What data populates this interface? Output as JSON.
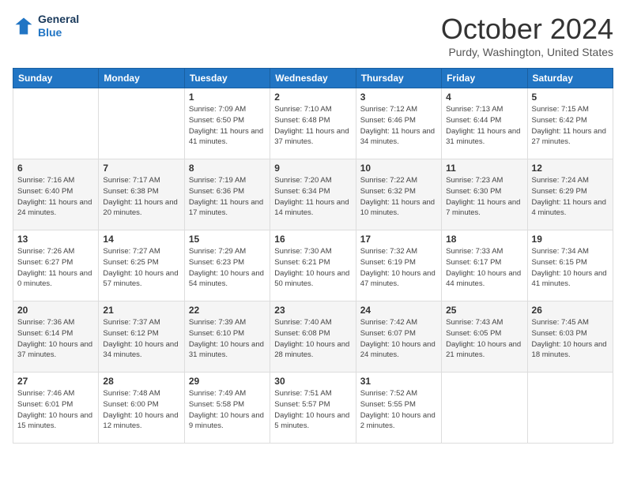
{
  "header": {
    "logo_line1": "General",
    "logo_line2": "Blue",
    "month": "October 2024",
    "location": "Purdy, Washington, United States"
  },
  "days_of_week": [
    "Sunday",
    "Monday",
    "Tuesday",
    "Wednesday",
    "Thursday",
    "Friday",
    "Saturday"
  ],
  "weeks": [
    [
      {
        "day": "",
        "info": ""
      },
      {
        "day": "",
        "info": ""
      },
      {
        "day": "1",
        "info": "Sunrise: 7:09 AM\nSunset: 6:50 PM\nDaylight: 11 hours and 41 minutes."
      },
      {
        "day": "2",
        "info": "Sunrise: 7:10 AM\nSunset: 6:48 PM\nDaylight: 11 hours and 37 minutes."
      },
      {
        "day": "3",
        "info": "Sunrise: 7:12 AM\nSunset: 6:46 PM\nDaylight: 11 hours and 34 minutes."
      },
      {
        "day": "4",
        "info": "Sunrise: 7:13 AM\nSunset: 6:44 PM\nDaylight: 11 hours and 31 minutes."
      },
      {
        "day": "5",
        "info": "Sunrise: 7:15 AM\nSunset: 6:42 PM\nDaylight: 11 hours and 27 minutes."
      }
    ],
    [
      {
        "day": "6",
        "info": "Sunrise: 7:16 AM\nSunset: 6:40 PM\nDaylight: 11 hours and 24 minutes."
      },
      {
        "day": "7",
        "info": "Sunrise: 7:17 AM\nSunset: 6:38 PM\nDaylight: 11 hours and 20 minutes."
      },
      {
        "day": "8",
        "info": "Sunrise: 7:19 AM\nSunset: 6:36 PM\nDaylight: 11 hours and 17 minutes."
      },
      {
        "day": "9",
        "info": "Sunrise: 7:20 AM\nSunset: 6:34 PM\nDaylight: 11 hours and 14 minutes."
      },
      {
        "day": "10",
        "info": "Sunrise: 7:22 AM\nSunset: 6:32 PM\nDaylight: 11 hours and 10 minutes."
      },
      {
        "day": "11",
        "info": "Sunrise: 7:23 AM\nSunset: 6:30 PM\nDaylight: 11 hours and 7 minutes."
      },
      {
        "day": "12",
        "info": "Sunrise: 7:24 AM\nSunset: 6:29 PM\nDaylight: 11 hours and 4 minutes."
      }
    ],
    [
      {
        "day": "13",
        "info": "Sunrise: 7:26 AM\nSunset: 6:27 PM\nDaylight: 11 hours and 0 minutes."
      },
      {
        "day": "14",
        "info": "Sunrise: 7:27 AM\nSunset: 6:25 PM\nDaylight: 10 hours and 57 minutes."
      },
      {
        "day": "15",
        "info": "Sunrise: 7:29 AM\nSunset: 6:23 PM\nDaylight: 10 hours and 54 minutes."
      },
      {
        "day": "16",
        "info": "Sunrise: 7:30 AM\nSunset: 6:21 PM\nDaylight: 10 hours and 50 minutes."
      },
      {
        "day": "17",
        "info": "Sunrise: 7:32 AM\nSunset: 6:19 PM\nDaylight: 10 hours and 47 minutes."
      },
      {
        "day": "18",
        "info": "Sunrise: 7:33 AM\nSunset: 6:17 PM\nDaylight: 10 hours and 44 minutes."
      },
      {
        "day": "19",
        "info": "Sunrise: 7:34 AM\nSunset: 6:15 PM\nDaylight: 10 hours and 41 minutes."
      }
    ],
    [
      {
        "day": "20",
        "info": "Sunrise: 7:36 AM\nSunset: 6:14 PM\nDaylight: 10 hours and 37 minutes."
      },
      {
        "day": "21",
        "info": "Sunrise: 7:37 AM\nSunset: 6:12 PM\nDaylight: 10 hours and 34 minutes."
      },
      {
        "day": "22",
        "info": "Sunrise: 7:39 AM\nSunset: 6:10 PM\nDaylight: 10 hours and 31 minutes."
      },
      {
        "day": "23",
        "info": "Sunrise: 7:40 AM\nSunset: 6:08 PM\nDaylight: 10 hours and 28 minutes."
      },
      {
        "day": "24",
        "info": "Sunrise: 7:42 AM\nSunset: 6:07 PM\nDaylight: 10 hours and 24 minutes."
      },
      {
        "day": "25",
        "info": "Sunrise: 7:43 AM\nSunset: 6:05 PM\nDaylight: 10 hours and 21 minutes."
      },
      {
        "day": "26",
        "info": "Sunrise: 7:45 AM\nSunset: 6:03 PM\nDaylight: 10 hours and 18 minutes."
      }
    ],
    [
      {
        "day": "27",
        "info": "Sunrise: 7:46 AM\nSunset: 6:01 PM\nDaylight: 10 hours and 15 minutes."
      },
      {
        "day": "28",
        "info": "Sunrise: 7:48 AM\nSunset: 6:00 PM\nDaylight: 10 hours and 12 minutes."
      },
      {
        "day": "29",
        "info": "Sunrise: 7:49 AM\nSunset: 5:58 PM\nDaylight: 10 hours and 9 minutes."
      },
      {
        "day": "30",
        "info": "Sunrise: 7:51 AM\nSunset: 5:57 PM\nDaylight: 10 hours and 5 minutes."
      },
      {
        "day": "31",
        "info": "Sunrise: 7:52 AM\nSunset: 5:55 PM\nDaylight: 10 hours and 2 minutes."
      },
      {
        "day": "",
        "info": ""
      },
      {
        "day": "",
        "info": ""
      }
    ]
  ]
}
